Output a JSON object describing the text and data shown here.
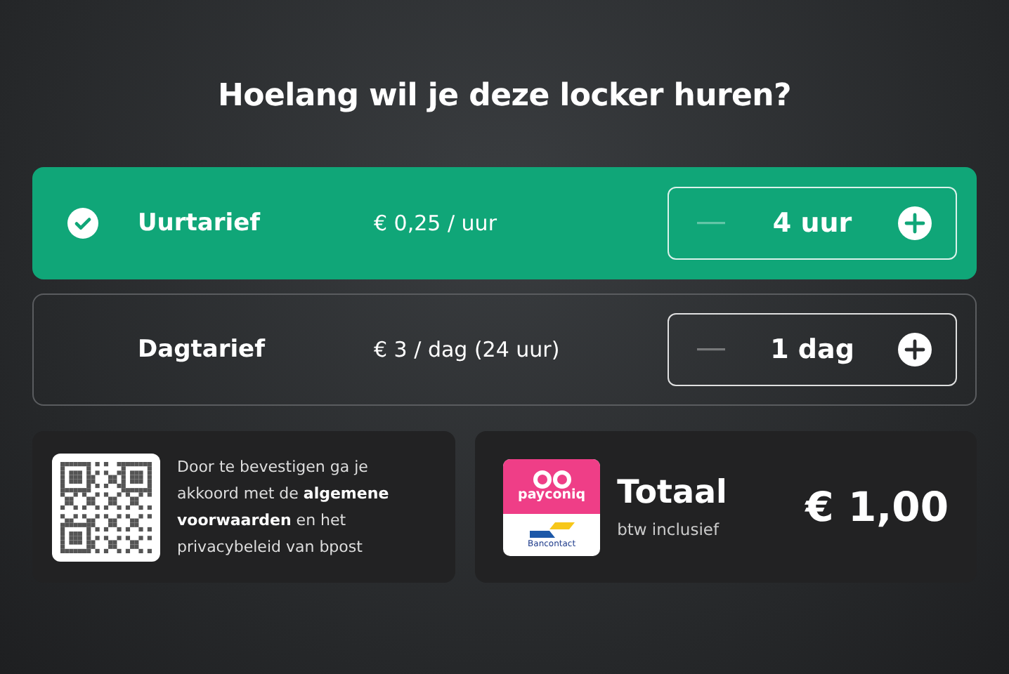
{
  "heading": "Hoelang wil je deze locker huren?",
  "rates": [
    {
      "name": "Uurtarief",
      "price": "€ 0,25 / uur",
      "quantity": "4 uur",
      "selected": true,
      "minus_disabled": true
    },
    {
      "name": "Dagtarief",
      "price": "€ 3 / dag (24 uur)",
      "quantity": "1 dag",
      "selected": false,
      "minus_disabled": true
    }
  ],
  "terms": {
    "text": "Door te bevestigen ga je akkoord met de **algemene voorwaarden** en het privacybeleid van bpost"
  },
  "payment": {
    "logos": [
      "payconiq",
      "Bancontact"
    ],
    "total_label": "Totaal",
    "vat_note": "btw inclusief",
    "total": "€ 1,00"
  }
}
